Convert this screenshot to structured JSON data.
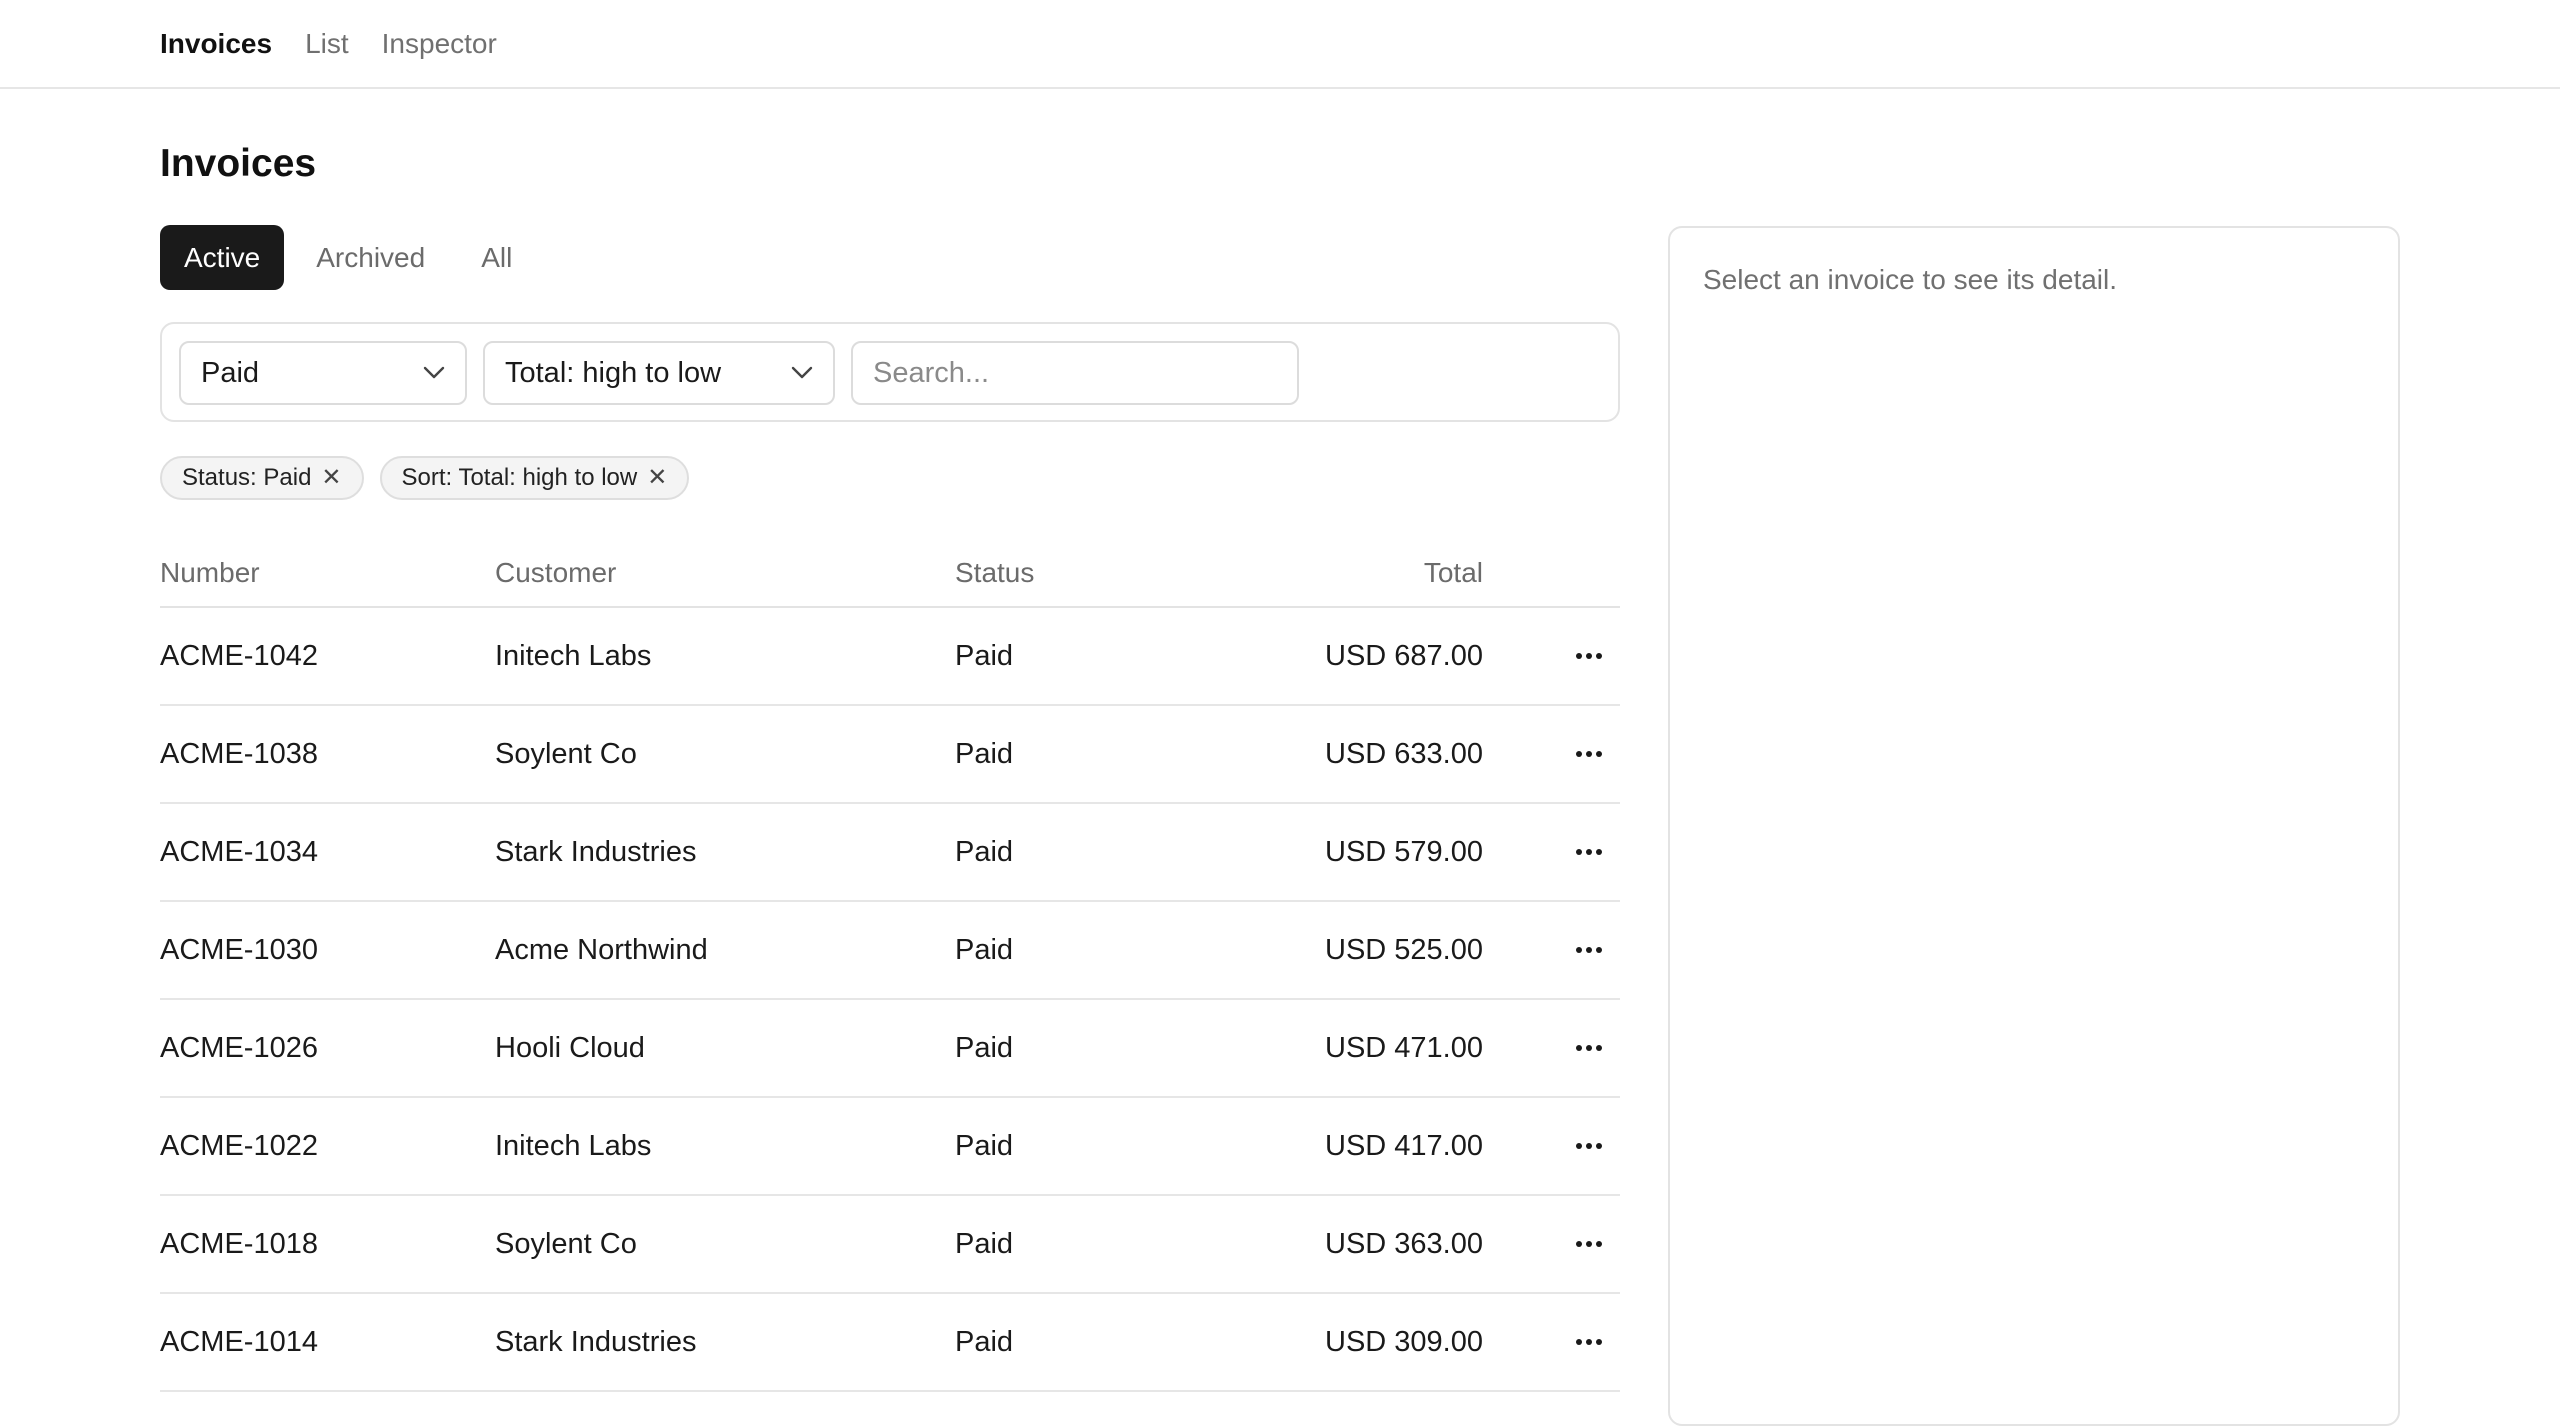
{
  "nav": {
    "items": [
      {
        "label": "Invoices"
      },
      {
        "label": "List"
      },
      {
        "label": "Inspector"
      }
    ]
  },
  "page": {
    "title": "Invoices"
  },
  "tabs": [
    {
      "label": "Active"
    },
    {
      "label": "Archived"
    },
    {
      "label": "All"
    }
  ],
  "filters": {
    "status_value": "Paid",
    "sort_value": "Total: high to low",
    "search_placeholder": "Search..."
  },
  "chips": [
    {
      "label": "Status: Paid"
    },
    {
      "label": "Sort: Total: high to low"
    }
  ],
  "table": {
    "headers": {
      "number": "Number",
      "customer": "Customer",
      "status": "Status",
      "total": "Total"
    },
    "rows": [
      {
        "number": "ACME-1042",
        "customer": "Initech Labs",
        "status": "Paid",
        "total": "USD 687.00"
      },
      {
        "number": "ACME-1038",
        "customer": "Soylent Co",
        "status": "Paid",
        "total": "USD 633.00"
      },
      {
        "number": "ACME-1034",
        "customer": "Stark Industries",
        "status": "Paid",
        "total": "USD 579.00"
      },
      {
        "number": "ACME-1030",
        "customer": "Acme Northwind",
        "status": "Paid",
        "total": "USD 525.00"
      },
      {
        "number": "ACME-1026",
        "customer": "Hooli Cloud",
        "status": "Paid",
        "total": "USD 471.00"
      },
      {
        "number": "ACME-1022",
        "customer": "Initech Labs",
        "status": "Paid",
        "total": "USD 417.00"
      },
      {
        "number": "ACME-1018",
        "customer": "Soylent Co",
        "status": "Paid",
        "total": "USD 363.00"
      },
      {
        "number": "ACME-1014",
        "customer": "Stark Industries",
        "status": "Paid",
        "total": "USD 309.00"
      }
    ]
  },
  "inspector": {
    "empty_text": "Select an invoice to see its detail."
  },
  "icons": {
    "select_chevron": "chevron-down-icon",
    "chip_remove": "close-icon",
    "row_actions": "more-horizontal-icon"
  }
}
